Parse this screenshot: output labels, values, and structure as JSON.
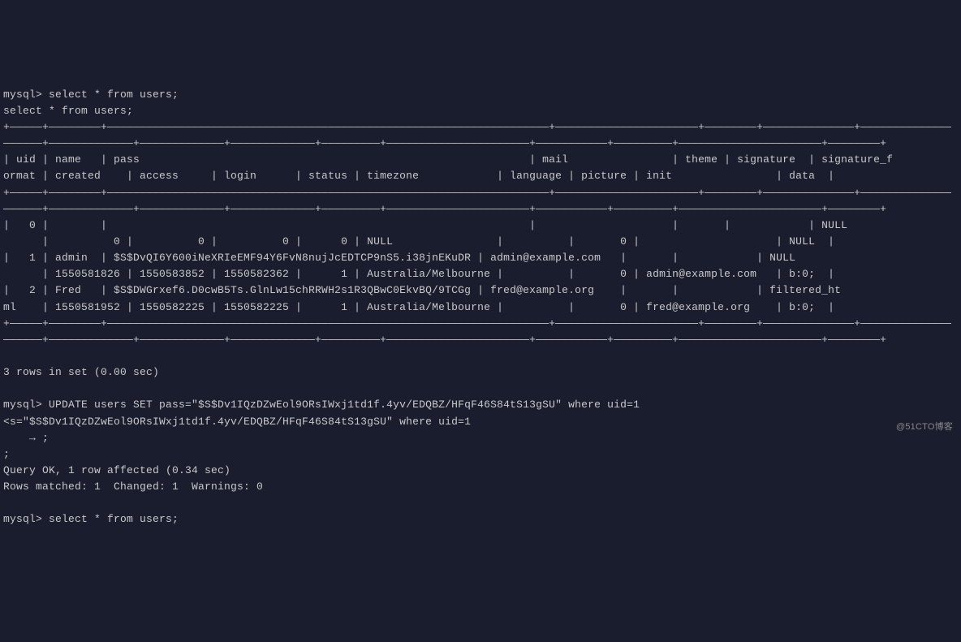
{
  "terminal": {
    "prompt1": "mysql> select * from users;",
    "echo1": "select * from users;",
    "border_top1": "+—————+————————+————————————————————————————————————————————————————————————————————+——————————————————————+————————+——————————————+——————————————",
    "border_top2": "——————+—————————————+—————————————+—————————————+—————————+——————————————————————+———————————+—————————+——————————————————————+————————+",
    "header1": "| uid | name   | pass                                                            | mail                | theme | signature  | signature_f",
    "header2": "ormat | created    | access     | login      | status | timezone            | language | picture | init                | data  |",
    "border_mid1": "+—————+————————+————————————————————————————————————————————————————————————————————+——————————————————————+————————+——————————————+——————————————",
    "border_mid2": "——————+—————————————+—————————————+—————————————+—————————+——————————————————————+———————————+—————————+——————————————————————+————————+",
    "row0_1": "|   0 |        |                                                                 |                     |       |            | NULL       ",
    "row0_2": "      |          0 |          0 |          0 |      0 | NULL                |          |       0 |                     | NULL  |",
    "row1_1": "|   1 | admin  | $S$DvQI6Y600iNeXRIeEMF94Y6FvN8nujJcEDTCP9nS5.i38jnEKuDR | admin@example.com   |       |            | NULL       ",
    "row1_2": "      | 1550581826 | 1550583852 | 1550582362 |      1 | Australia/Melbourne |          |       0 | admin@example.com   | b:0;  |",
    "row2_1": "|   2 | Fred   | $S$DWGrxef6.D0cwB5Ts.GlnLw15chRRWH2s1R3QBwC0EkvBQ/9TCGg | fred@example.org    |       |            | filtered_ht",
    "row2_2": "ml    | 1550581952 | 1550582225 | 1550582225 |      1 | Australia/Melbourne |          |       0 | fred@example.org    | b:0;  |",
    "border_bot1": "+—————+————————+————————————————————————————————————————————————————————————————————+——————————————————————+————————+——————————————+——————————————",
    "border_bot2": "——————+—————————————+—————————————+—————————————+—————————+——————————————————————+———————————+—————————+——————————————————————+————————+",
    "rowcount": "3 rows in set (0.00 sec)",
    "prompt2": "mysql> UPDATE users SET pass=\"$S$Dv1IQzDZwEol9ORsIWxj1td1f.4yv/EDQBZ/HFqF46S84tS13gSU\" where uid=1",
    "echo2": "<s=\"$S$Dv1IQzDZwEol9ORsIWxj1td1f.4yv/EDQBZ/HFqF46S84tS13gSU\" where uid=1",
    "continuation": "    → ;",
    "semi": ";",
    "result1": "Query OK, 1 row affected (0.34 sec)",
    "result2": "Rows matched: 1  Changed: 1  Warnings: 0",
    "prompt3": "mysql> select * from users;",
    "watermark": "@51CTO博客"
  }
}
